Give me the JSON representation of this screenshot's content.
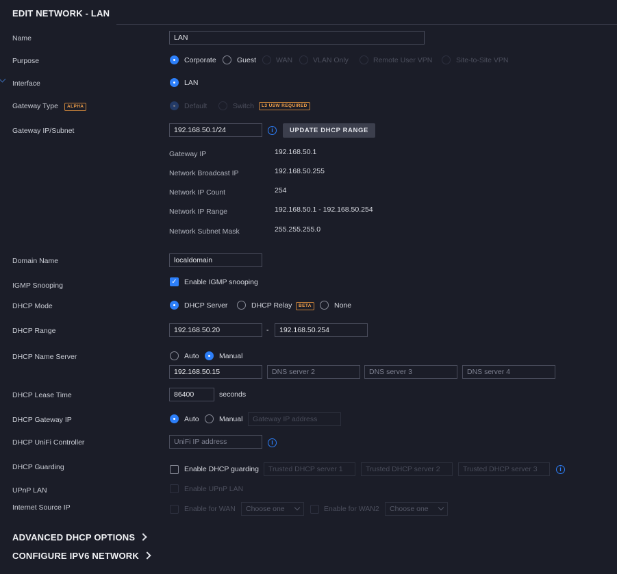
{
  "page": {
    "title": "EDIT NETWORK - LAN"
  },
  "labels": {
    "name": "Name",
    "purpose": "Purpose",
    "interface": "Interface",
    "gateway_type": "Gateway Type",
    "gateway_subnet": "Gateway IP/Subnet",
    "domain_name": "Domain Name",
    "igmp_snooping": "IGMP Snooping",
    "dhcp_mode": "DHCP Mode",
    "dhcp_range": "DHCP Range",
    "dhcp_name_server": "DHCP Name Server",
    "dhcp_lease_time": "DHCP Lease Time",
    "dhcp_gateway_ip": "DHCP Gateway IP",
    "dhcp_unifi_controller": "DHCP UniFi Controller",
    "dhcp_guarding": "DHCP Guarding",
    "upnp_lan": "UPnP LAN",
    "internet_source_ip": "Internet Source IP"
  },
  "name": {
    "value": "LAN"
  },
  "purpose": {
    "options": [
      "Corporate",
      "Guest",
      "WAN",
      "VLAN Only",
      "Remote User VPN",
      "Site-to-Site VPN"
    ],
    "selected": "Corporate"
  },
  "interface": {
    "option": "LAN",
    "selected": true
  },
  "gateway_type": {
    "badge": "ALPHA",
    "options": [
      "Default",
      "Switch"
    ],
    "switch_badge": "L3 USW REQUIRED"
  },
  "gateway_subnet": {
    "value": "192.168.50.1/24",
    "info_icon": "info-icon",
    "update_button": "UPDATE DHCP RANGE"
  },
  "subnet_info": [
    {
      "key": "Gateway IP",
      "value": "192.168.50.1"
    },
    {
      "key": "Network Broadcast IP",
      "value": "192.168.50.255"
    },
    {
      "key": "Network IP Count",
      "value": "254"
    },
    {
      "key": "Network IP Range",
      "value": "192.168.50.1 - 192.168.50.254"
    },
    {
      "key": "Network Subnet Mask",
      "value": "255.255.255.0"
    }
  ],
  "domain_name": {
    "value": "localdomain"
  },
  "igmp": {
    "label": "Enable IGMP snooping",
    "checked": true
  },
  "dhcp_mode": {
    "options": [
      "DHCP Server",
      "DHCP Relay",
      "None"
    ],
    "relay_badge": "BETA",
    "selected": "DHCP Server"
  },
  "dhcp_range": {
    "start": "192.168.50.20",
    "separator": "-",
    "end": "192.168.50.254"
  },
  "dhcp_name_server": {
    "options": [
      "Auto",
      "Manual"
    ],
    "selected": "Manual",
    "server1": "192.168.50.15",
    "server2_placeholder": "DNS server 2",
    "server3_placeholder": "DNS server 3",
    "server4_placeholder": "DNS server 4"
  },
  "dhcp_lease_time": {
    "value": "86400",
    "unit": "seconds"
  },
  "dhcp_gateway_ip": {
    "options": [
      "Auto",
      "Manual"
    ],
    "selected": "Auto",
    "placeholder": "Gateway IP address"
  },
  "dhcp_unifi_controller": {
    "placeholder": "UniFi IP address"
  },
  "dhcp_guarding": {
    "label": "Enable DHCP guarding",
    "checked": false,
    "server1_placeholder": "Trusted DHCP server 1",
    "server2_placeholder": "Trusted DHCP server 2",
    "server3_placeholder": "Trusted DHCP server 3"
  },
  "upnp": {
    "label": "Enable UPnP LAN"
  },
  "internet_source": {
    "wan_label": "Enable for WAN",
    "wan_select": "Choose one",
    "wan2_label": "Enable for WAN2",
    "wan2_select": "Choose one"
  },
  "sections": {
    "advanced_dhcp": "ADVANCED DHCP OPTIONS",
    "ipv6": "CONFIGURE IPV6 NETWORK"
  },
  "colors": {
    "accent": "#2d7ff9",
    "background": "#1b1d28",
    "badge": "#f0a04b"
  }
}
